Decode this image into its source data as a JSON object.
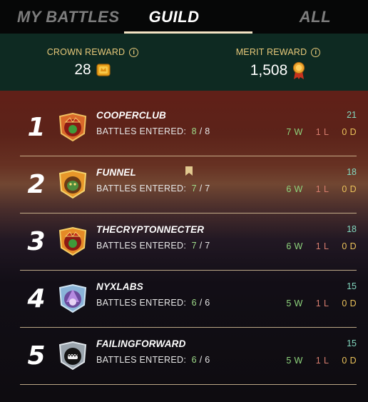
{
  "tabs": [
    {
      "label": "MY BATTLES",
      "active": false
    },
    {
      "label": "GUILD",
      "active": true
    },
    {
      "label": "ALL",
      "active": false
    }
  ],
  "rewards": {
    "crown": {
      "title": "CROWN REWARD",
      "value": "28",
      "icon": "crown-token-icon"
    },
    "merit": {
      "title": "MERIT REWARD",
      "value": "1,508",
      "icon": "merit-medal-icon"
    }
  },
  "battles_label": "BATTLES ENTERED:",
  "rows": [
    {
      "rank": "1",
      "name": "COOPERCLUB",
      "entered": "8",
      "total": "8",
      "score": "21",
      "wins": "7 W",
      "losses": "1 L",
      "draws": "0 D",
      "bookmarked": false,
      "emblem": "red-jester-emblem"
    },
    {
      "rank": "2",
      "name": "FUNNEL",
      "entered": "7",
      "total": "7",
      "score": "18",
      "wins": "6 W",
      "losses": "1 L",
      "draws": "0 D",
      "bookmarked": true,
      "emblem": "orange-goblin-emblem"
    },
    {
      "rank": "3",
      "name": "THECRYPTONNECTER",
      "entered": "7",
      "total": "7",
      "score": "18",
      "wins": "6 W",
      "losses": "1 L",
      "draws": "0 D",
      "bookmarked": false,
      "emblem": "red-jester-emblem"
    },
    {
      "rank": "4",
      "name": "NYXLABS",
      "entered": "6",
      "total": "6",
      "score": "15",
      "wins": "5 W",
      "losses": "1 L",
      "draws": "0 D",
      "bookmarked": false,
      "emblem": "purple-wizard-emblem"
    },
    {
      "rank": "5",
      "name": "FAILINGFORWARD",
      "entered": "6",
      "total": "6",
      "score": "15",
      "wins": "5 W",
      "losses": "1 L",
      "draws": "0 D",
      "bookmarked": false,
      "emblem": "grey-monster-emblem"
    }
  ],
  "colors": {
    "tab_underline": "#f3e3c4",
    "reward_title": "#e8c97a",
    "wins": "#8ed47c",
    "losses": "#d77d6e",
    "draws": "#eac25a",
    "score": "#83d9c0"
  }
}
